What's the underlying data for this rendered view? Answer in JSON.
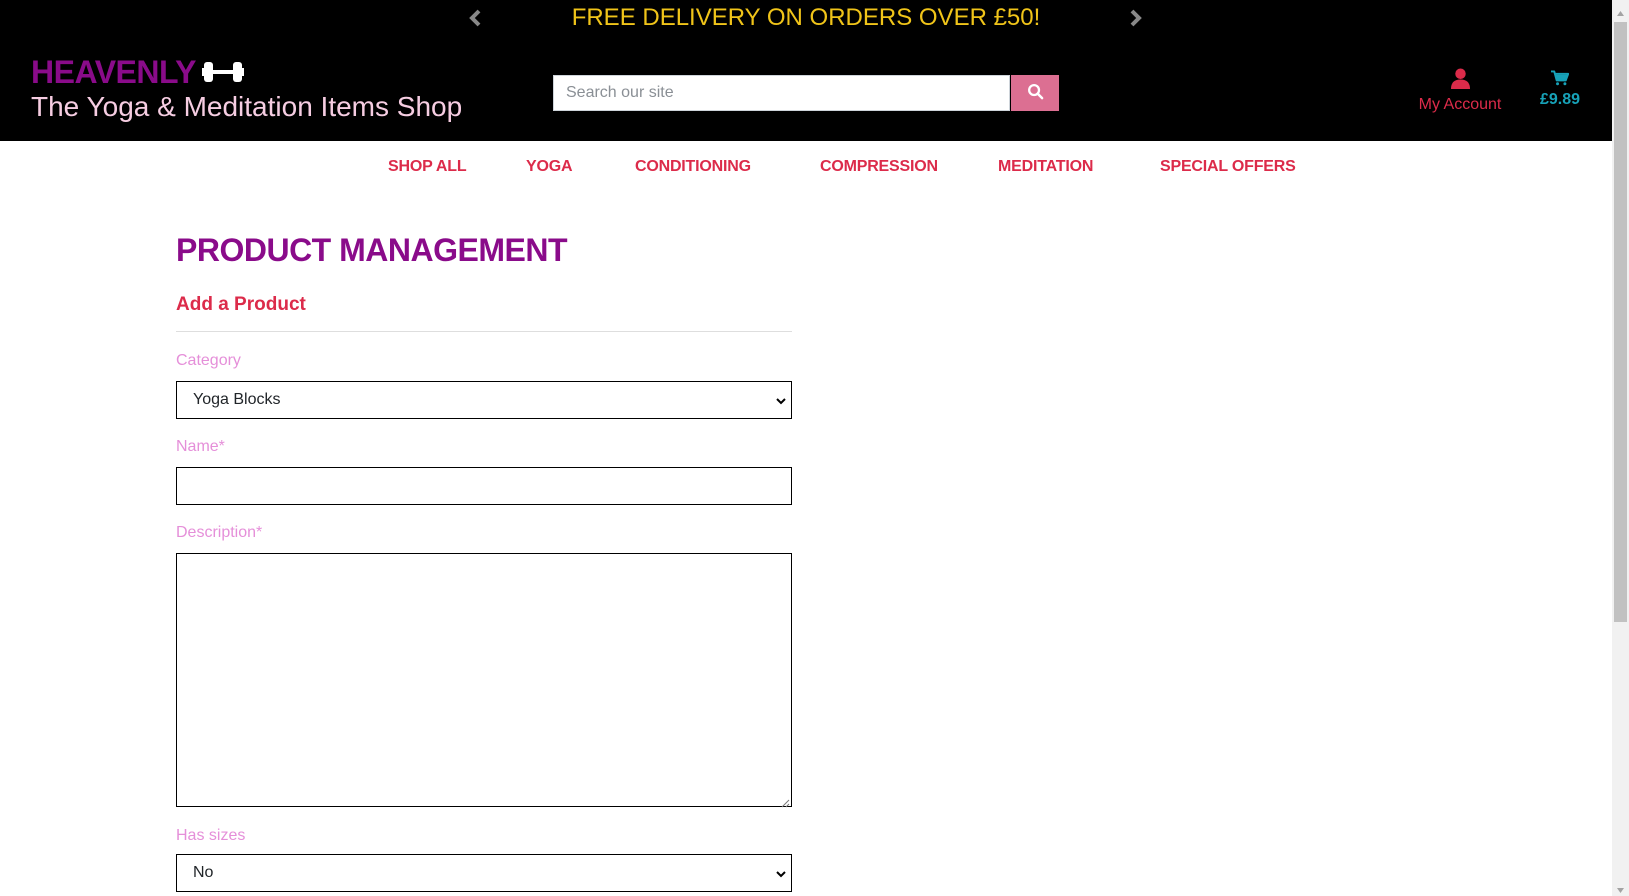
{
  "promo": {
    "text": "FREE DELIVERY ON ORDERS OVER £50!",
    "prev_icon": "chevron-left-icon",
    "next_icon": "chevron-right-icon",
    "color": "#f0c419"
  },
  "logo": {
    "brand": "HEAVENLY",
    "tagline": "The Yoga & Meditation Items Shop",
    "icon": "dumbbell-icon"
  },
  "search": {
    "placeholder": "Search our site",
    "value": "",
    "icon": "search-icon"
  },
  "account": {
    "label": "My Account",
    "icon": "user-icon"
  },
  "cart": {
    "total": "£9.89",
    "icon": "cart-icon"
  },
  "nav": {
    "items": [
      {
        "label": "SHOP ALL"
      },
      {
        "label": "YOGA"
      },
      {
        "label": "CONDITIONING"
      },
      {
        "label": "COMPRESSION"
      },
      {
        "label": "MEDITATION"
      },
      {
        "label": "SPECIAL OFFERS"
      }
    ]
  },
  "page": {
    "title": "PRODUCT MANAGEMENT",
    "subtitle": "Add a Product"
  },
  "form": {
    "category": {
      "label": "Category",
      "value": "Yoga Blocks"
    },
    "name": {
      "label": "Name*",
      "value": ""
    },
    "description": {
      "label": "Description*",
      "value": ""
    },
    "has_sizes": {
      "label": "Has sizes",
      "value": "No"
    }
  },
  "colors": {
    "brand_purple": "#8a0b8a",
    "accent_red": "#dc2b4a",
    "label_pink": "#e58fd9",
    "search_button": "#dc6f92",
    "cart_teal": "#17a2b8"
  }
}
